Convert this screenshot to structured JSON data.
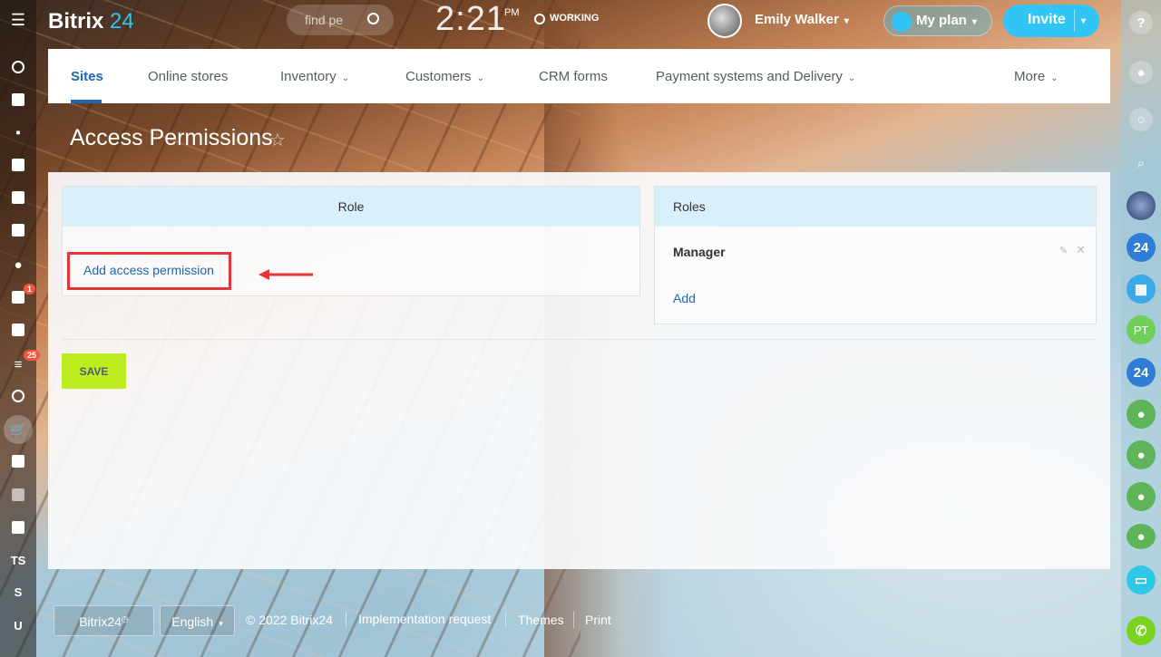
{
  "header": {
    "logo_text": "Bitrix",
    "logo_num": "24",
    "search_placeholder": "find pe",
    "clock_time": "2:21",
    "clock_period": "PM",
    "work_status": "WORKING",
    "user_name": "Emily Walker",
    "my_plan_label": "My plan",
    "invite_label": "Invite"
  },
  "left_sidebar": {
    "mail_badge": "1",
    "feed_badge": "25",
    "ts_label": "TS",
    "s_label": "S",
    "u_label": "U"
  },
  "right_sidebar": {
    "help_label": "?",
    "bitrix_badge_1": "24",
    "user_initials": "PT",
    "bitrix_badge_2": "24"
  },
  "nav": {
    "items": [
      {
        "label": "Sites"
      },
      {
        "label": "Online stores"
      },
      {
        "label": "Inventory"
      },
      {
        "label": "Customers"
      },
      {
        "label": "CRM forms"
      },
      {
        "label": "Payment systems and Delivery"
      },
      {
        "label": "More"
      }
    ]
  },
  "page": {
    "title": "Access Permissions",
    "role_header": "Role",
    "add_permission_label": "Add access permission",
    "roles_header": "Roles",
    "role_name": "Manager",
    "add_role_label": "Add",
    "save_label": "SAVE"
  },
  "footer": {
    "brand": "Bitrix24",
    "language": "English",
    "copyright": "© 2022 Bitrix24",
    "implementation": "Implementation request",
    "themes": "Themes",
    "print": "Print"
  },
  "colors": {
    "accent": "#2fc6f6",
    "link": "#2066b0",
    "save": "#bbed21",
    "highlight": "#e8353a"
  }
}
